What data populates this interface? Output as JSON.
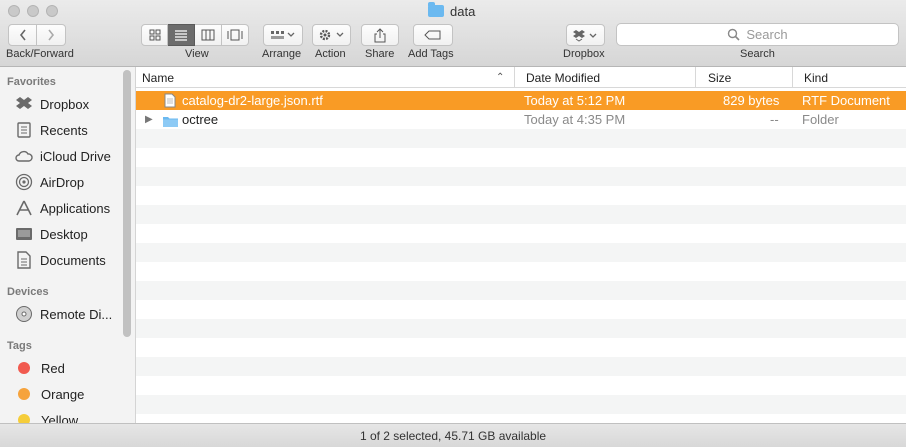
{
  "window": {
    "title": "data",
    "folder_icon": "folder-icon"
  },
  "toolbar": {
    "back_forward_label": "Back/Forward",
    "view_label": "View",
    "arrange_label": "Arrange",
    "action_label": "Action",
    "share_label": "Share",
    "add_tags_label": "Add Tags",
    "dropbox_label": "Dropbox",
    "search_label": "Search",
    "search_placeholder": "Search",
    "active_view": "list"
  },
  "sidebar": {
    "favorites_heading": "Favorites",
    "favorites": [
      {
        "label": "Dropbox",
        "icon": "dropbox-icon"
      },
      {
        "label": "Recents",
        "icon": "recents-icon"
      },
      {
        "label": "iCloud Drive",
        "icon": "cloud-icon"
      },
      {
        "label": "AirDrop",
        "icon": "airdrop-icon"
      },
      {
        "label": "Applications",
        "icon": "applications-icon"
      },
      {
        "label": "Desktop",
        "icon": "desktop-icon"
      },
      {
        "label": "Documents",
        "icon": "documents-icon"
      }
    ],
    "devices_heading": "Devices",
    "devices": [
      {
        "label": "Remote Di...",
        "icon": "disc-icon"
      }
    ],
    "tags_heading": "Tags",
    "tags": [
      {
        "label": "Red",
        "color": "#f15a4f"
      },
      {
        "label": "Orange",
        "color": "#f6a33c"
      },
      {
        "label": "Yellow",
        "color": "#f5cd3a"
      }
    ]
  },
  "list": {
    "columns": {
      "name": "Name",
      "date": "Date Modified",
      "size": "Size",
      "kind": "Kind"
    },
    "rows": [
      {
        "name": "catalog-dr2-large.json.rtf",
        "date": "Today at 5:12 PM",
        "size": "829 bytes",
        "kind": "RTF Document",
        "selected": true,
        "type": "file"
      },
      {
        "name": "octree",
        "date": "Today at 4:35 PM",
        "size": "--",
        "kind": "Folder",
        "selected": false,
        "type": "folder"
      }
    ]
  },
  "status": {
    "text": "1 of 2 selected, 45.71 GB available"
  },
  "colors": {
    "selection": "#f99b25",
    "folder": "#6bb9f0"
  }
}
